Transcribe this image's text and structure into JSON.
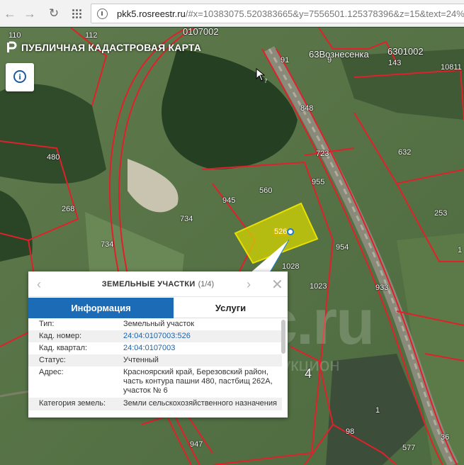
{
  "browser": {
    "url_host": "pkk5.rosreestr.ru",
    "url_rest": "/#x=10383075.520383665&y=7556501.125378396&z=15&text=24%"
  },
  "map": {
    "title": "ПУБЛИЧНАЯ КАДАСТРОВАЯ КАРТА",
    "labels": [
      "110",
      "112",
      "0107002",
      "63Вознесенка",
      "6301002",
      "143",
      "10811",
      "91",
      "9",
      "848",
      "723",
      "955",
      "632",
      "480",
      "560",
      "268",
      "945",
      "734",
      "526",
      "734",
      "253",
      "1028",
      "954",
      "1023",
      "933",
      "4",
      "947",
      "577",
      "1",
      "98",
      "36",
      "1"
    ],
    "selected_parcel": "526",
    "watermark": "c.ru",
    "watermark_sub": "интернет-аукцион"
  },
  "popup": {
    "title": "ЗЕМЕЛЬНЫЕ УЧАСТКИ",
    "counter": "(1/4)",
    "tabs": [
      "Информация",
      "Услуги"
    ],
    "rows": [
      {
        "k": "Тип:",
        "v": "Земельный участок"
      },
      {
        "k": "Кад. номер:",
        "v": "24:04:0107003:526"
      },
      {
        "k": "Кад. квартал:",
        "v": "24:04:0107003"
      },
      {
        "k": "Статус:",
        "v": "Учтенный"
      },
      {
        "k": "Адрес:",
        "v": "Красноярский край, Березовский район, часть контура пашни 480, пастбищ 262А, участок № 6"
      },
      {
        "k": "Категория земель:",
        "v": "Земли сельскохозяйственного назначения"
      }
    ]
  }
}
